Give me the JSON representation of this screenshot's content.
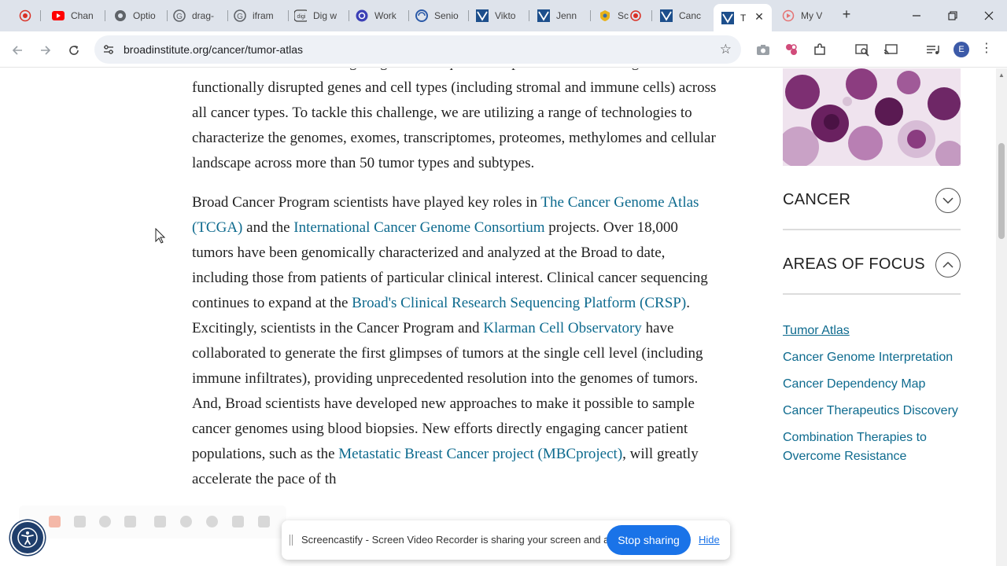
{
  "tabs": [
    {
      "title": "",
      "icon": "record-icon"
    },
    {
      "title": "Chan",
      "icon": "youtube-icon"
    },
    {
      "title": "Optio",
      "icon": "globe-icon"
    },
    {
      "title": "drag-",
      "icon": "google-icon"
    },
    {
      "title": "ifram",
      "icon": "google-icon"
    },
    {
      "title": "Dig w",
      "icon": "digi-icon"
    },
    {
      "title": "Work",
      "icon": "work-icon"
    },
    {
      "title": "Senio",
      "icon": "seniority-icon"
    },
    {
      "title": "Vikto",
      "icon": "broad-icon"
    },
    {
      "title": "Jenn",
      "icon": "broad-icon"
    },
    {
      "title": "Sc",
      "icon": "shield-icon"
    },
    {
      "title": "Canc",
      "icon": "broad-icon"
    },
    {
      "title": "T",
      "icon": "broad-icon",
      "active": true
    },
    {
      "title": "My V",
      "icon": "video-icon"
    }
  ],
  "browser": {
    "url": "broadinstitute.org/cancer/tumor-atlas",
    "profile_initial": "E",
    "menu_glyph": "⋮"
  },
  "article": {
    "p1": {
      "text": "molecular mechanisms. Fighting cancer requires comprehensive knowledge of functionally disrupted genes and cell types (including stromal and immune cells) across all cancer types. To tackle this challenge, we are utilizing a range of technologies to characterize the genomes, exomes, transcriptomes, proteomes, methylomes and cellular landscape across more than 50 tumor types and subtypes."
    },
    "p2": {
      "t1": "Broad Cancer Program scientists have played key roles in ",
      "link_tcga": "The Cancer Genome Atlas (TCGA)",
      "t2": " and the ",
      "link_icgc": "International Cancer Genome Consortium",
      "t3": " projects. Over 18,000 tumors have been genomically characterized and analyzed at the Broad to date, including those from patients of particular clinical interest. Clinical cancer sequencing continues to expand at the ",
      "link_crsp": "Broad's Clinical Research Sequencing Platform (CRSP)",
      "t4": ". Excitingly, scientists in the Cancer Program and ",
      "link_klarman": "Klarman Cell Observatory",
      "t5": " have collaborated to generate the first glimpses of tumors at the single cell level (including immune infiltrates), providing unprecedented resolution into the genomes of tumors. And, Broad scientists have developed new approaches to make it possible to sample cancer genomes using blood biopsies. New efforts directly engaging cancer patient populations, such as the ",
      "link_mbc": "Metastatic Breast Cancer project (MBCproject)",
      "t6": ", will greatly accelerate the pace of th"
    }
  },
  "sidebar": {
    "cancer_label": "CANCER",
    "areas_label": "AREAS OF FOCUS",
    "links": [
      {
        "label": "Tumor Atlas",
        "current": true
      },
      {
        "label": "Cancer Genome Interpretation"
      },
      {
        "label": "Cancer Dependency Map"
      },
      {
        "label": "Cancer Therapeutics Discovery"
      },
      {
        "label": "Combination Therapies to Overcome Resistance"
      }
    ]
  },
  "share_bar": {
    "message": "Screencastify - Screen Video Recorder is sharing your screen and audio.",
    "stop_label": "Stop sharing",
    "hide_label": "Hide"
  },
  "colors": {
    "link": "#0d6a8e",
    "stop_button": "#1a73e8",
    "accessibility_button": "#1f3e6b"
  }
}
